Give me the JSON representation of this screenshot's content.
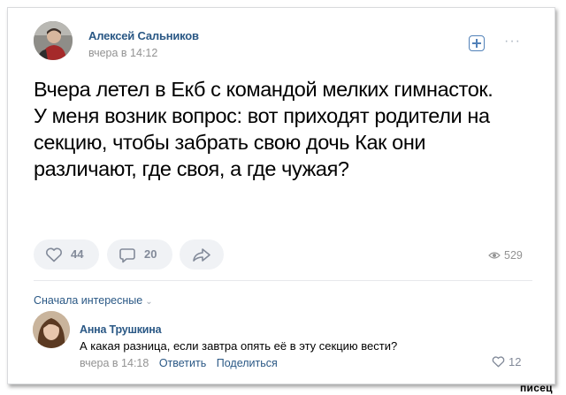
{
  "post": {
    "author": "Алексей Сальников",
    "time": "вчера в 14:12",
    "text": "Вчера летел в Екб с командой мелких гимнасток. У меня возник вопрос: вот приходят родители на секцию, чтобы забрать свою дочь Как они различают, где своя, а где чужая?",
    "likes": "44",
    "comments": "20",
    "views": "529",
    "icons": [
      "add-icon",
      "more-icon",
      "heart-icon",
      "comment-icon",
      "share-icon",
      "eye-icon"
    ]
  },
  "comments_section": {
    "sort_label": "Сначала интересные",
    "comment": {
      "author": "Анна Трушкина",
      "text": "А какая разница, если завтра опять её в эту секцию вести?",
      "time": "вчера в 14:18",
      "reply_label": "Ответить",
      "share_label": "Поделиться",
      "likes": "12"
    }
  },
  "watermark": "писец",
  "colors": {
    "link": "#2a5885",
    "muted": "#939393",
    "accent": "#5181b8",
    "pill_bg": "#f0f2f5"
  }
}
